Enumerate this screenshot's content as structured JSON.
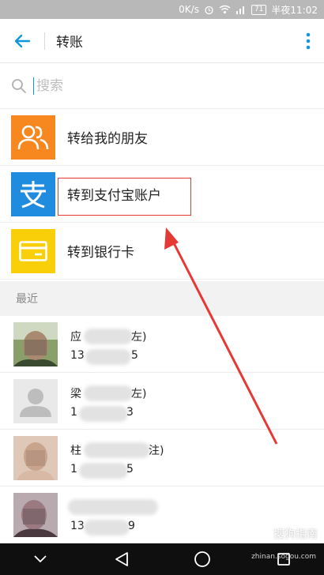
{
  "status_bar": {
    "speed": "0K/s",
    "battery": "71",
    "time": "半夜11:02",
    "icons": [
      "alarm-icon",
      "wifi-icon",
      "signal-icon",
      "battery-icon"
    ]
  },
  "app_bar": {
    "title": "转账",
    "back_icon": "back-arrow-icon",
    "more_icon": "more-vertical-icon"
  },
  "search": {
    "placeholder": "搜索",
    "icon": "search-icon"
  },
  "options": [
    {
      "label": "转给我的朋友",
      "icon": "friends-icon",
      "color": "#f7871f"
    },
    {
      "label": "转到支付宝账户",
      "icon": "alipay-icon",
      "color": "#1f8ce0"
    },
    {
      "label": "转到银行卡",
      "icon": "bank-card-icon",
      "color": "#f9cf0a"
    }
  ],
  "recent": {
    "header": "最近",
    "contacts": [
      {
        "name_prefix": "应",
        "name_suffix": "左)",
        "acct_prefix": "13",
        "acct_suffix": "5"
      },
      {
        "name_prefix": "梁",
        "name_suffix": "左)",
        "acct_prefix": "1",
        "acct_suffix": "3"
      },
      {
        "name_prefix": "柱",
        "name_suffix": "注)",
        "acct_prefix": "1",
        "acct_suffix": "5"
      },
      {
        "name_prefix": "",
        "name_suffix": "",
        "acct_prefix": "13",
        "acct_suffix": "9"
      }
    ]
  },
  "nav_bar": {
    "icons": [
      "nav-collapse-icon",
      "nav-back-icon",
      "nav-home-icon",
      "nav-recents-icon"
    ]
  },
  "annotation": {
    "box_color": "#e53935"
  },
  "watermark": {
    "text": "搜狗指南",
    "url": "zhinan.sogou.com"
  }
}
